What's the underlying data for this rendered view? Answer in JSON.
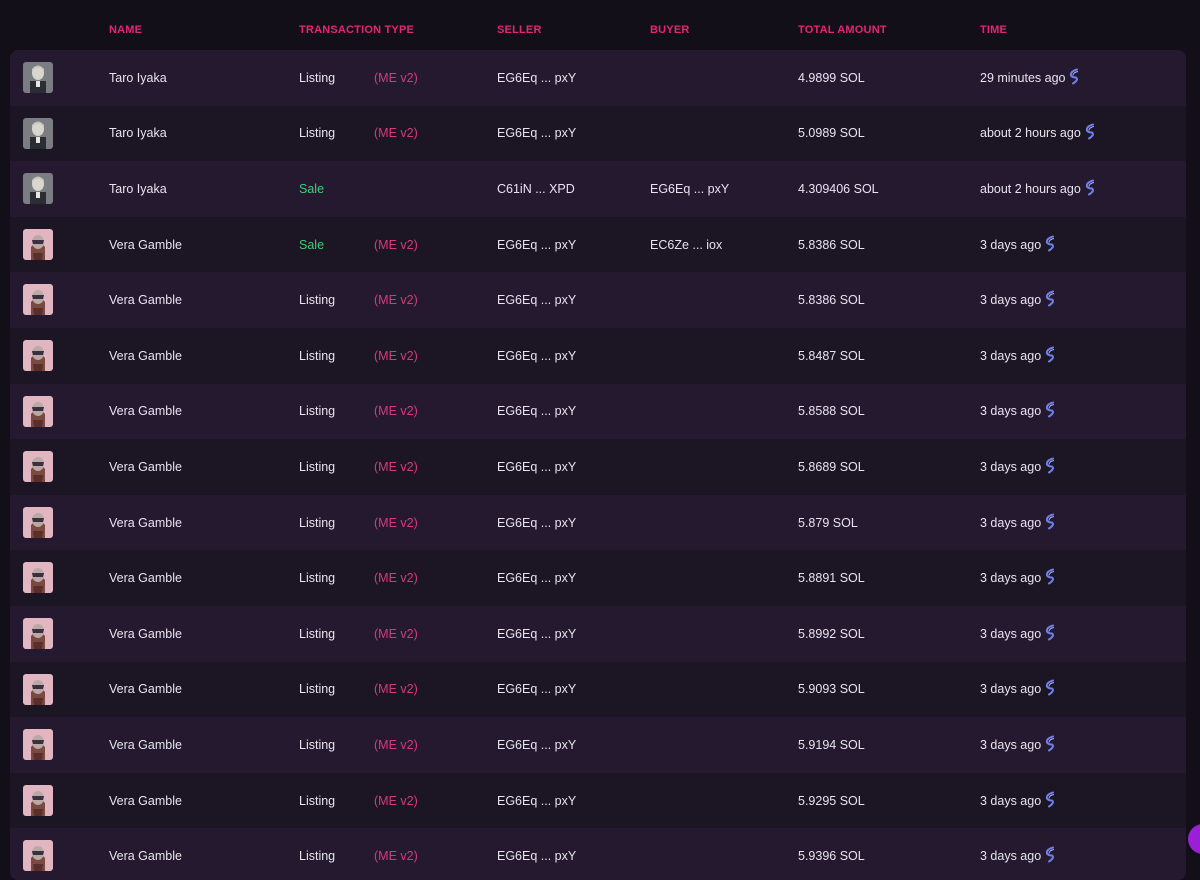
{
  "columns": {
    "name": "NAME",
    "type": "TRANSACTION TYPE",
    "seller": "SELLER",
    "buyer": "BUYER",
    "amount": "TOTAL AMOUNT",
    "time": "TIME"
  },
  "colors": {
    "accent": "#e42575",
    "sale": "#3ecf7a",
    "market": "#d63a7c",
    "row_odd": "#24192f",
    "row_even": "#1b1524"
  },
  "rows": [
    {
      "avatar": "male-portrait",
      "name": "Taro Iyaka",
      "type": "Listing",
      "type_kind": "listing",
      "market": "(ME v2)",
      "seller": "EG6Eq ... pxY",
      "buyer": "",
      "amount": "4.9899 SOL",
      "time": "29 minutes ago",
      "icon": "solana-icon"
    },
    {
      "avatar": "male-portrait",
      "name": "Taro Iyaka",
      "type": "Listing",
      "type_kind": "listing",
      "market": "(ME v2)",
      "seller": "EG6Eq ... pxY",
      "buyer": "",
      "amount": "5.0989 SOL",
      "time": "about 2 hours ago",
      "icon": "solana-icon"
    },
    {
      "avatar": "male-portrait",
      "name": "Taro Iyaka",
      "type": "Sale",
      "type_kind": "sale",
      "market": "",
      "seller": "C61iN ... XPD",
      "buyer": "EG6Eq ... pxY",
      "amount": "4.309406 SOL",
      "time": "about 2 hours ago",
      "icon": "solana-icon"
    },
    {
      "avatar": "female-portrait",
      "name": "Vera Gamble",
      "type": "Sale",
      "type_kind": "sale",
      "market": "(ME v2)",
      "seller": "EG6Eq ... pxY",
      "buyer": "EC6Ze ... iox",
      "amount": "5.8386 SOL",
      "time": "3 days ago",
      "icon": "solana-icon"
    },
    {
      "avatar": "female-portrait",
      "name": "Vera Gamble",
      "type": "Listing",
      "type_kind": "listing",
      "market": "(ME v2)",
      "seller": "EG6Eq ... pxY",
      "buyer": "",
      "amount": "5.8386 SOL",
      "time": "3 days ago",
      "icon": "solana-icon"
    },
    {
      "avatar": "female-portrait",
      "name": "Vera Gamble",
      "type": "Listing",
      "type_kind": "listing",
      "market": "(ME v2)",
      "seller": "EG6Eq ... pxY",
      "buyer": "",
      "amount": "5.8487 SOL",
      "time": "3 days ago",
      "icon": "solana-icon"
    },
    {
      "avatar": "female-portrait",
      "name": "Vera Gamble",
      "type": "Listing",
      "type_kind": "listing",
      "market": "(ME v2)",
      "seller": "EG6Eq ... pxY",
      "buyer": "",
      "amount": "5.8588 SOL",
      "time": "3 days ago",
      "icon": "solana-icon"
    },
    {
      "avatar": "female-portrait",
      "name": "Vera Gamble",
      "type": "Listing",
      "type_kind": "listing",
      "market": "(ME v2)",
      "seller": "EG6Eq ... pxY",
      "buyer": "",
      "amount": "5.8689 SOL",
      "time": "3 days ago",
      "icon": "solana-icon"
    },
    {
      "avatar": "female-portrait",
      "name": "Vera Gamble",
      "type": "Listing",
      "type_kind": "listing",
      "market": "(ME v2)",
      "seller": "EG6Eq ... pxY",
      "buyer": "",
      "amount": "5.879 SOL",
      "time": "3 days ago",
      "icon": "solana-icon"
    },
    {
      "avatar": "female-portrait",
      "name": "Vera Gamble",
      "type": "Listing",
      "type_kind": "listing",
      "market": "(ME v2)",
      "seller": "EG6Eq ... pxY",
      "buyer": "",
      "amount": "5.8891 SOL",
      "time": "3 days ago",
      "icon": "solana-icon"
    },
    {
      "avatar": "female-portrait",
      "name": "Vera Gamble",
      "type": "Listing",
      "type_kind": "listing",
      "market": "(ME v2)",
      "seller": "EG6Eq ... pxY",
      "buyer": "",
      "amount": "5.8992 SOL",
      "time": "3 days ago",
      "icon": "solana-icon"
    },
    {
      "avatar": "female-portrait",
      "name": "Vera Gamble",
      "type": "Listing",
      "type_kind": "listing",
      "market": "(ME v2)",
      "seller": "EG6Eq ... pxY",
      "buyer": "",
      "amount": "5.9093 SOL",
      "time": "3 days ago",
      "icon": "solana-icon"
    },
    {
      "avatar": "female-portrait",
      "name": "Vera Gamble",
      "type": "Listing",
      "type_kind": "listing",
      "market": "(ME v2)",
      "seller": "EG6Eq ... pxY",
      "buyer": "",
      "amount": "5.9194 SOL",
      "time": "3 days ago",
      "icon": "solana-icon"
    },
    {
      "avatar": "female-portrait",
      "name": "Vera Gamble",
      "type": "Listing",
      "type_kind": "listing",
      "market": "(ME v2)",
      "seller": "EG6Eq ... pxY",
      "buyer": "",
      "amount": "5.9295 SOL",
      "time": "3 days ago",
      "icon": "solana-icon"
    },
    {
      "avatar": "female-portrait",
      "name": "Vera Gamble",
      "type": "Listing",
      "type_kind": "listing",
      "market": "(ME v2)",
      "seller": "EG6Eq ... pxY",
      "buyer": "",
      "amount": "5.9396 SOL",
      "time": "3 days ago",
      "icon": "solana-icon"
    }
  ]
}
